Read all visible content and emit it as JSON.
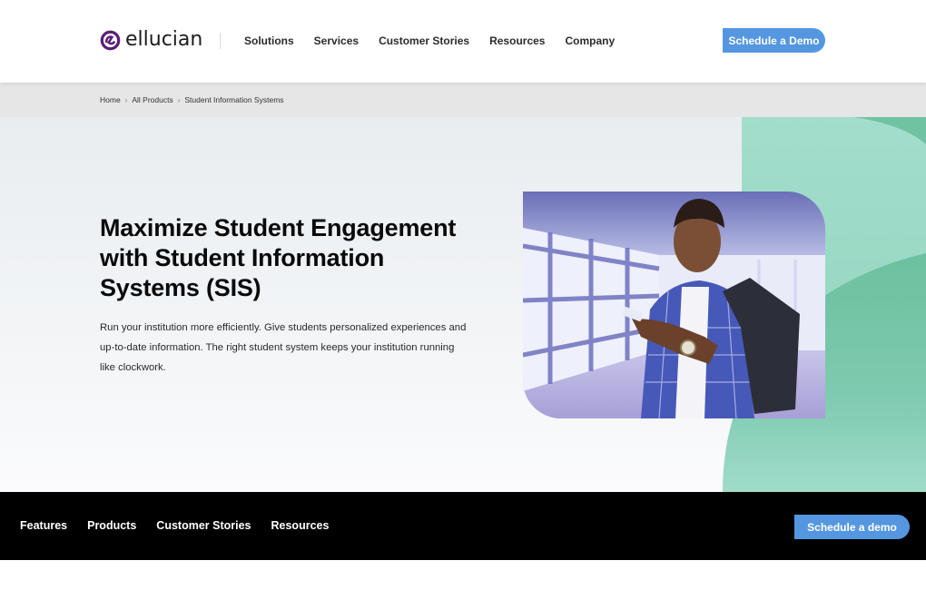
{
  "header": {
    "logo_text": "ellucian",
    "logo_icon": "ellucian-logo-mark",
    "nav": [
      {
        "label": "Solutions"
      },
      {
        "label": "Services"
      },
      {
        "label": "Customer Stories"
      },
      {
        "label": "Resources"
      },
      {
        "label": "Company"
      }
    ],
    "cta_label": "Schedule a Demo"
  },
  "breadcrumb": {
    "items": [
      {
        "label": "Home"
      },
      {
        "label": "All Products"
      },
      {
        "label": "Student Information Systems"
      }
    ],
    "separator": "›"
  },
  "hero": {
    "title": "Maximize Student Engagement with Student Information Systems (SIS)",
    "description": "Run your institution more efficiently. Give students personalized experiences and up-to-date information. The right student system keeps your institution running like clockwork.",
    "image_alt": "Smiling student with backpack looking at phone in a glass walkway"
  },
  "subnav": {
    "links": [
      {
        "label": "Features"
      },
      {
        "label": "Products"
      },
      {
        "label": "Customer Stories"
      },
      {
        "label": "Resources"
      }
    ],
    "cta_label": "Schedule a demo"
  },
  "colors": {
    "brand_purple": "#5b1f74",
    "cta_blue": "#5497e0",
    "mint": "#a0dcca",
    "green": "#6fc2a2",
    "subnav_bg": "#000000",
    "breadcrumb_bg": "#e6e6e6"
  }
}
